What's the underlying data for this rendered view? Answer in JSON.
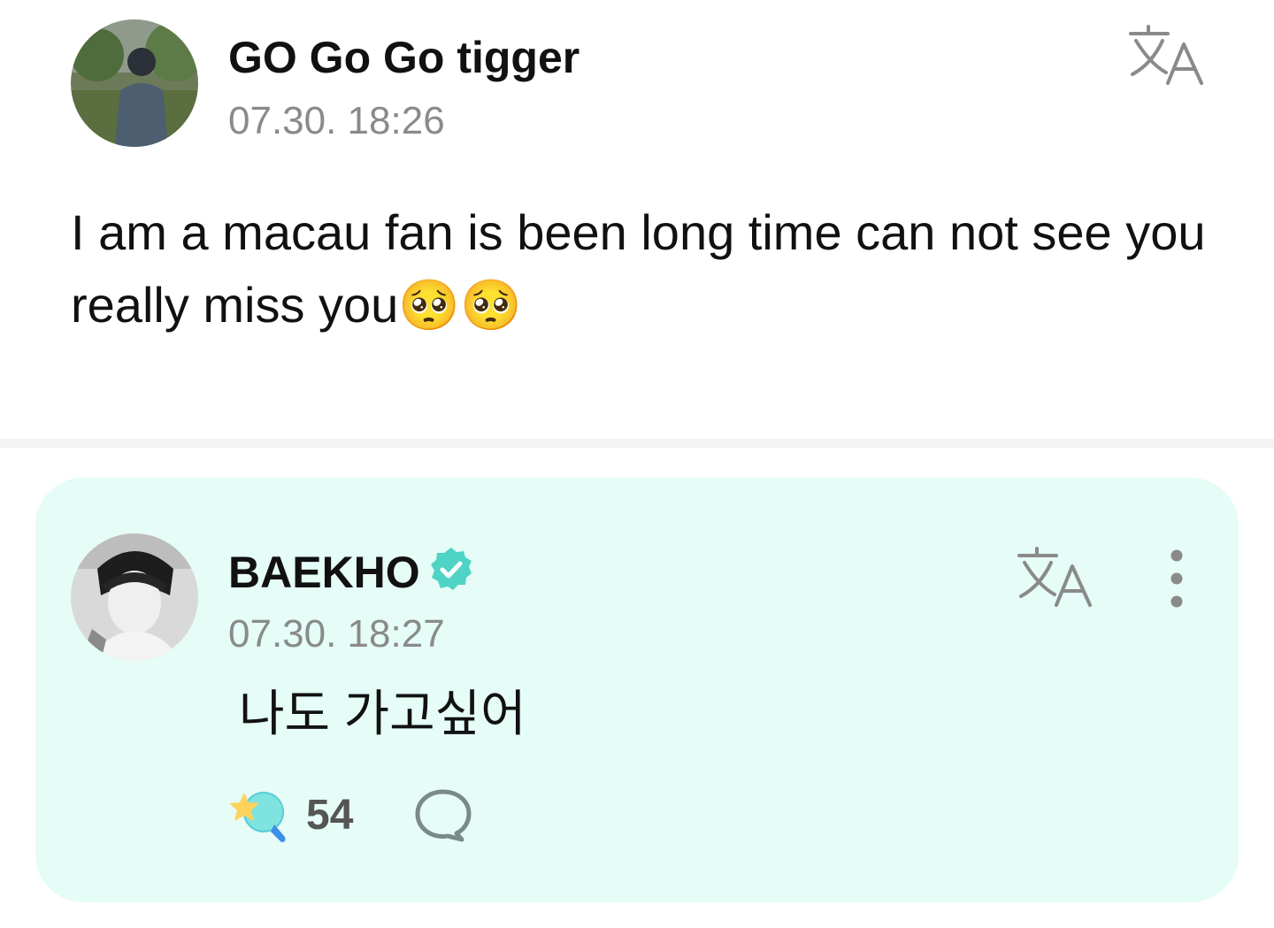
{
  "post": {
    "author": "GO Go Go tigger",
    "timestamp": "07.30. 18:26",
    "body": "I am a macau fan is been long time can not see you really miss you🥺🥺",
    "avatar_icon": "user-photo-avatar",
    "translate_icon": "translate-icon"
  },
  "reply": {
    "author": "BAEKHO",
    "verified": true,
    "verified_color": "#4fd3c4",
    "timestamp": "07.30. 18:27",
    "body": "나도 가고싶어",
    "like_count": "54",
    "avatar_icon": "artist-photo-avatar",
    "translate_icon": "translate-icon",
    "more_icon": "more-vertical-icon",
    "cheer_icon": "cheer-icon",
    "comment_icon": "comment-icon",
    "background_color": "#e5fcf7"
  }
}
